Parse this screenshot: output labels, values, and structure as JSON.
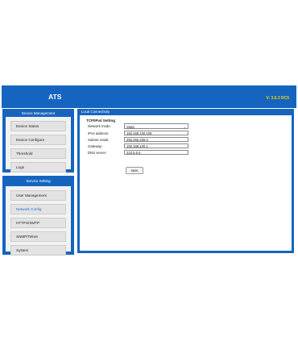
{
  "app": {
    "title": "ATS",
    "version": "V: 3.6.3 RC5"
  },
  "device_panel": {
    "title": "Device Management",
    "items": [
      {
        "label": "Device Status"
      },
      {
        "label": "Device Configure"
      },
      {
        "label": "Threshold"
      },
      {
        "label": "Logs"
      }
    ]
  },
  "service_panel": {
    "title": "Service Setting",
    "items": [
      {
        "label": "User Management"
      },
      {
        "label": "Network Config"
      },
      {
        "label": "HTTPS/SMTP"
      },
      {
        "label": "SNMP/Telnet"
      },
      {
        "label": "System"
      }
    ]
  },
  "main": {
    "title": "Local Connectivity",
    "section": "TCP/IPv4 Setting",
    "network_mode_label": "Network mode:",
    "network_mode_value": "Static",
    "ipv4_label": "IPv4 address:",
    "ipv4_value": "192.168.100.109",
    "subnet_label": "Subnet mask:",
    "subnet_value": "255.255.255.0",
    "gateway_label": "Gateway:",
    "gateway_value": "192.168.100.1",
    "dns_label": "DNS server:",
    "dns_value": "223.5.5.5",
    "save_label": "save"
  }
}
